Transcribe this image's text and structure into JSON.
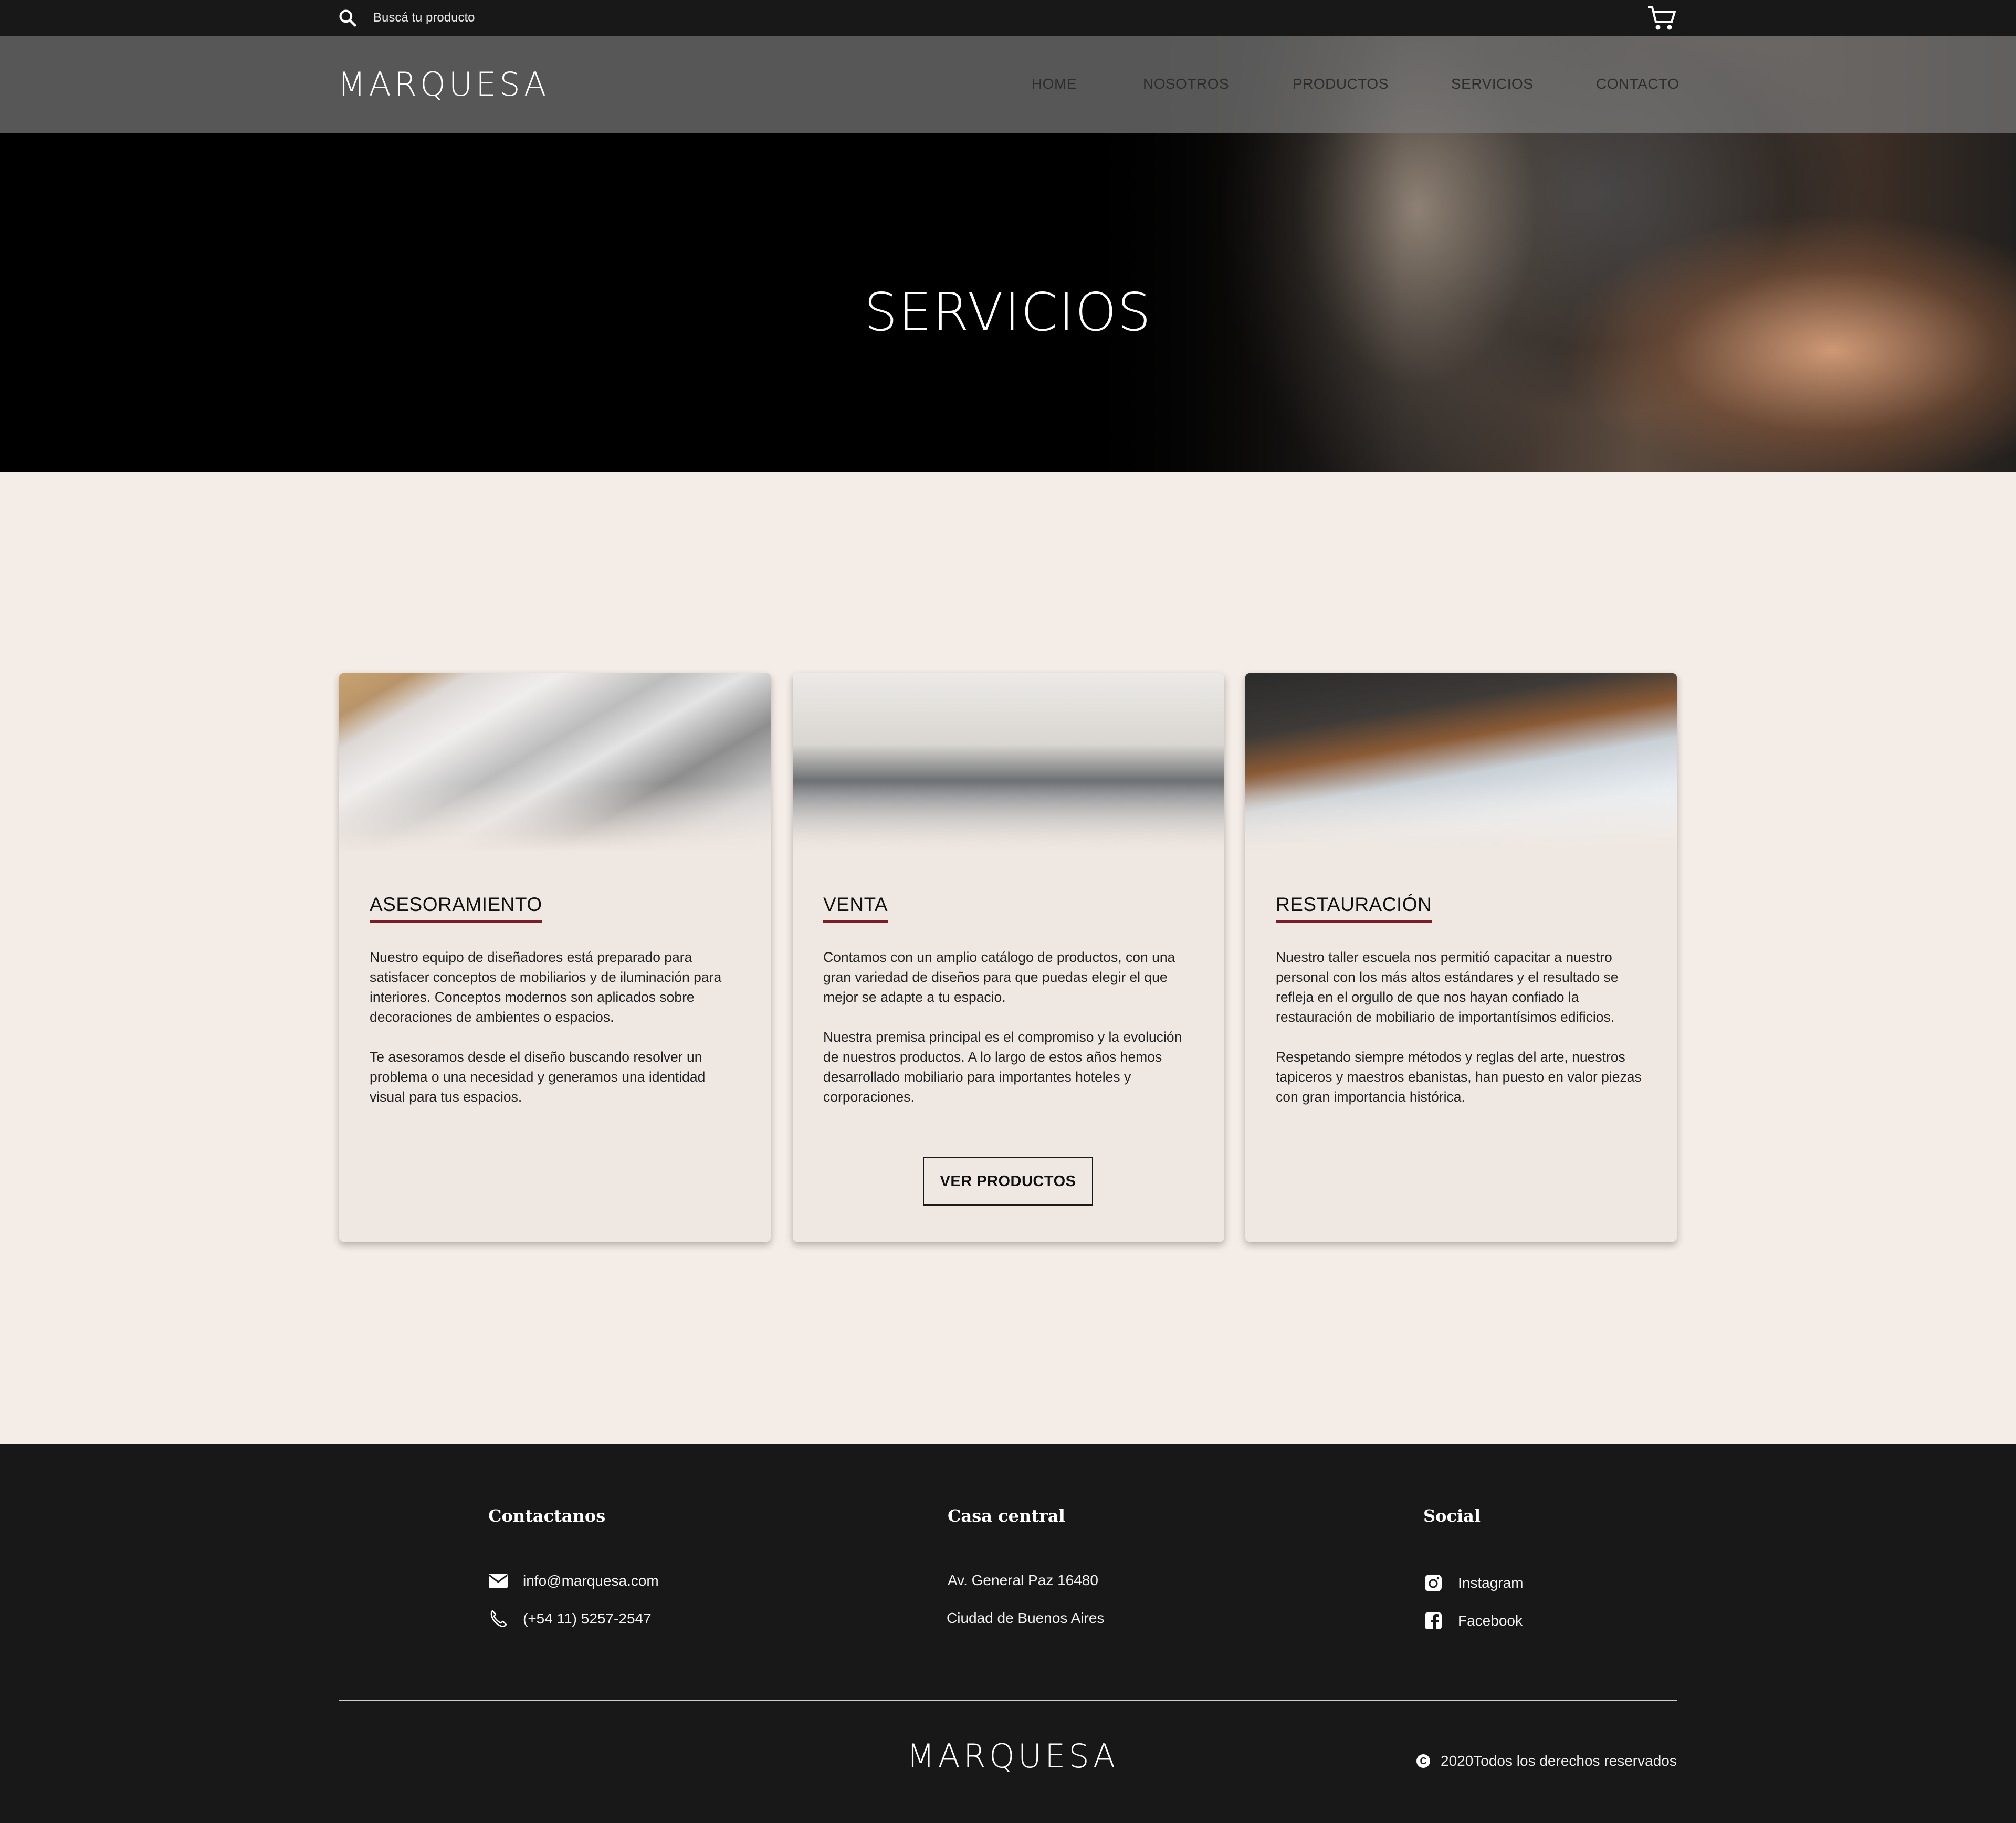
{
  "topbar": {
    "search_placeholder": "Buscá tu producto",
    "search_icon": "search-icon",
    "cart_icon": "cart-icon"
  },
  "brand": {
    "name": "MARQUESA",
    "accent_color": "#7c1c2a"
  },
  "nav": {
    "items": [
      {
        "label": "HOME"
      },
      {
        "label": "NOSOTROS"
      },
      {
        "label": "PRODUCTOS"
      },
      {
        "label": "SERVICIOS"
      },
      {
        "label": "CONTACTO"
      }
    ]
  },
  "hero": {
    "title": "SERVICIOS"
  },
  "cards": [
    {
      "title": "ASESORAMIENTO",
      "paragraphs": [
        "Nuestro equipo de diseñadores está preparado para satisfacer conceptos de mobiliarios y de iluminación para interiores. Conceptos modernos son aplicados sobre decoraciones de ambientes o espacios.",
        "Te asesoramos desde el diseño buscando resolver un problema o una necesidad y generamos una identidad visual para tus espacios."
      ]
    },
    {
      "title": "VENTA",
      "paragraphs": [
        "Contamos con un amplio catálogo de productos, con una gran variedad de diseños para que puedas elegir el que mejor se adapte a tu espacio.",
        "Nuestra premisa principal es el compromiso y la evolución de nuestros productos. A lo largo de estos años hemos desarrollado mobiliario para importantes hoteles y corporaciones."
      ],
      "button": "VER PRODUCTOS"
    },
    {
      "title": "RESTAURACIÓN",
      "paragraphs": [
        "Nuestro taller escuela nos permitió capacitar a nuestro personal con los más altos estándares y el resultado se refleja en el orgullo de que nos hayan confiado la restauración de mobiliario de importantísimos edificios.",
        "Respetando siempre métodos y reglas del arte, nuestros tapiceros y maestros ebanistas, han puesto en valor piezas con gran importancia histórica."
      ]
    }
  ],
  "footer": {
    "contact": {
      "heading": "Contactanos",
      "email": "info@marquesa.com",
      "phone": "(+54 11) 5257-2547"
    },
    "office": {
      "heading": "Casa central",
      "address": "Av. General Paz 16480",
      "city": "Ciudad de Buenos Aires"
    },
    "social": {
      "heading": "Social",
      "instagram": "Instagram",
      "facebook": "Facebook"
    },
    "copyright_symbol": "C",
    "copyright": "2020Todos los derechos reservados"
  }
}
